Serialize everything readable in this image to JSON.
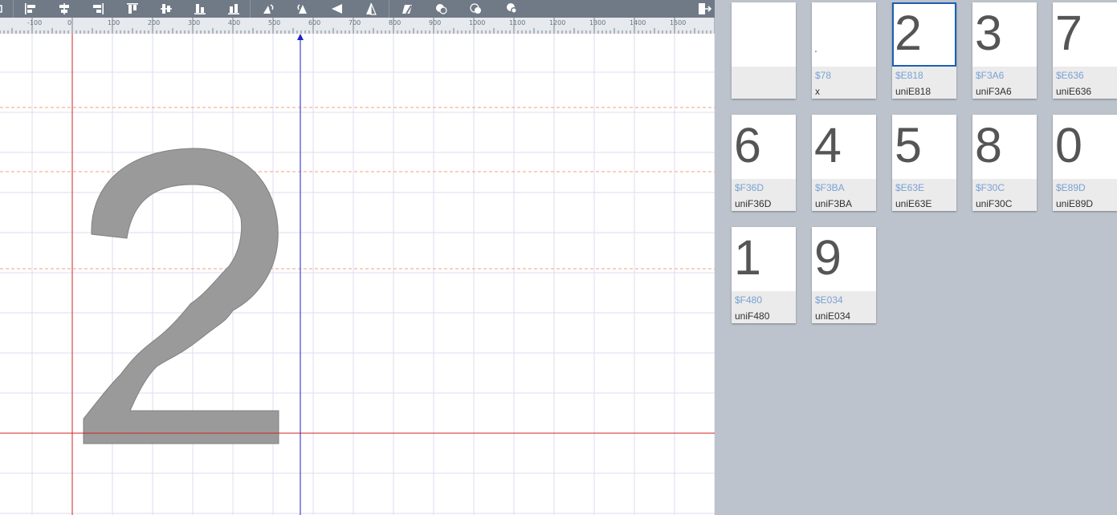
{
  "toolbar": {
    "buttons": [
      {
        "name": "align-left-button",
        "icon": "align-left-icon"
      },
      {
        "name": "align-center-vertical-button",
        "icon": "align-center-icon"
      },
      {
        "name": "align-right-button",
        "icon": "align-right-icon"
      },
      {
        "name": "align-top-button",
        "icon": "align-top-icon"
      },
      {
        "name": "align-middle-button",
        "icon": "align-middle-icon"
      },
      {
        "name": "align-bottom-button",
        "icon": "align-bottom-icon"
      },
      {
        "name": "distribute-button",
        "icon": "distribute-icon"
      },
      {
        "name": "rotate-left-button",
        "icon": "rotate-left-icon"
      },
      {
        "name": "rotate-right-button",
        "icon": "rotate-right-icon"
      },
      {
        "name": "flip-horizontal-button",
        "icon": "flip-horizontal-icon"
      },
      {
        "name": "flip-vertical-button",
        "icon": "flip-vertical-icon"
      },
      {
        "name": "union-button",
        "icon": "union-icon"
      },
      {
        "name": "subtract-button",
        "icon": "subtract-icon"
      },
      {
        "name": "intersect-button",
        "icon": "intersect-icon"
      },
      {
        "name": "exclude-button",
        "icon": "exclude-icon"
      }
    ],
    "right_icon": "exit-panel-icon",
    "color": "#707a86"
  },
  "ruler": {
    "labels": [
      "-100",
      "0",
      "100",
      "200",
      "300",
      "400",
      "500",
      "600",
      "700",
      "800",
      "900",
      "1000",
      "1100",
      "1200",
      "1300",
      "1400",
      "1500"
    ]
  },
  "editor": {
    "glyph_char": "2",
    "glyph_color": "#9a9a9a",
    "baseline_color": "#d42020",
    "advance_line_color": "#1a22c8",
    "guide_color": "#f0a080"
  },
  "glyph_panel": {
    "selected_color": "#1c5fb5",
    "glyphs": [
      {
        "char": "",
        "code": "",
        "name": ""
      },
      {
        "char": ".",
        "code": "$78",
        "name": "x"
      },
      {
        "char": "2",
        "code": "$E818",
        "name": "uniE818",
        "selected": true
      },
      {
        "char": "3",
        "code": "$F3A6",
        "name": "uniF3A6"
      },
      {
        "char": "7",
        "code": "$E636",
        "name": "uniE636"
      },
      {
        "char": "6",
        "code": "$F36D",
        "name": "uniF36D"
      },
      {
        "char": "4",
        "code": "$F3BA",
        "name": "uniF3BA"
      },
      {
        "char": "5",
        "code": "$E63E",
        "name": "uniE63E"
      },
      {
        "char": "8",
        "code": "$F30C",
        "name": "uniF30C"
      },
      {
        "char": "0",
        "code": "$E89D",
        "name": "uniE89D"
      },
      {
        "char": "1",
        "code": "$F480",
        "name": "uniF480"
      },
      {
        "char": "9",
        "code": "$E034",
        "name": "uniE034"
      }
    ]
  }
}
